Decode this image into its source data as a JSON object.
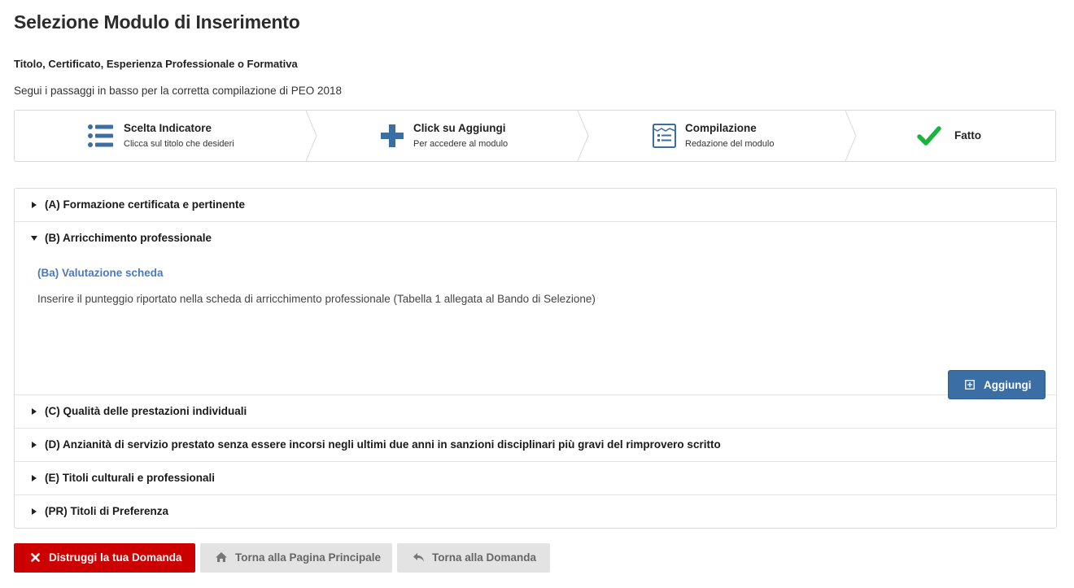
{
  "page": {
    "title": "Selezione Modulo di Inserimento",
    "subtitle": "Titolo, Certificato, Esperienza Professionale o Formativa",
    "intro": "Segui i passaggi in basso per la corretta compilazione di PEO 2018"
  },
  "steps": [
    {
      "title": "Scelta Indicatore",
      "desc": "Clicca sul titolo che desideri",
      "icon": "list-icon"
    },
    {
      "title": "Click su Aggiungi",
      "desc": "Per accedere al modulo",
      "icon": "plus-icon"
    },
    {
      "title": "Compilazione",
      "desc": "Redazione del modulo",
      "icon": "form-icon"
    },
    {
      "title": "Fatto",
      "desc": "",
      "icon": "check-icon"
    }
  ],
  "sections": [
    {
      "label": "(A) Formazione certificata e pertinente",
      "expanded": false
    },
    {
      "label": "(B) Arricchimento professionale",
      "expanded": true
    },
    {
      "label": "(C) Qualità delle prestazioni individuali",
      "expanded": false
    },
    {
      "label": "(D) Anzianità di servizio prestato senza essere incorsi negli ultimi due anni in sanzioni disciplinari più gravi del rimprovero scritto",
      "expanded": false
    },
    {
      "label": "(E) Titoli culturali e professionali",
      "expanded": false
    },
    {
      "label": "(PR) Titoli di Preferenza",
      "expanded": false
    }
  ],
  "expanded_section": {
    "sub_title": "(Ba) Valutazione scheda",
    "sub_desc": "Inserire il punteggio riportato nella scheda di arricchimento professionale (Tabella 1 allegata al Bando di Selezione)",
    "add_label": "Aggiungi"
  },
  "footer": {
    "destroy_label": "Distruggi la tua Domanda",
    "home_label": "Torna alla Pagina Principale",
    "back_label": "Torna alla Domanda"
  },
  "colors": {
    "step_icon": "#3a6ea5",
    "check": "#19b43c",
    "link": "#4a7ac0",
    "primary_button": "#3a6ea5",
    "danger_button": "#cc0000",
    "secondary_button": "#e3e3e3"
  }
}
